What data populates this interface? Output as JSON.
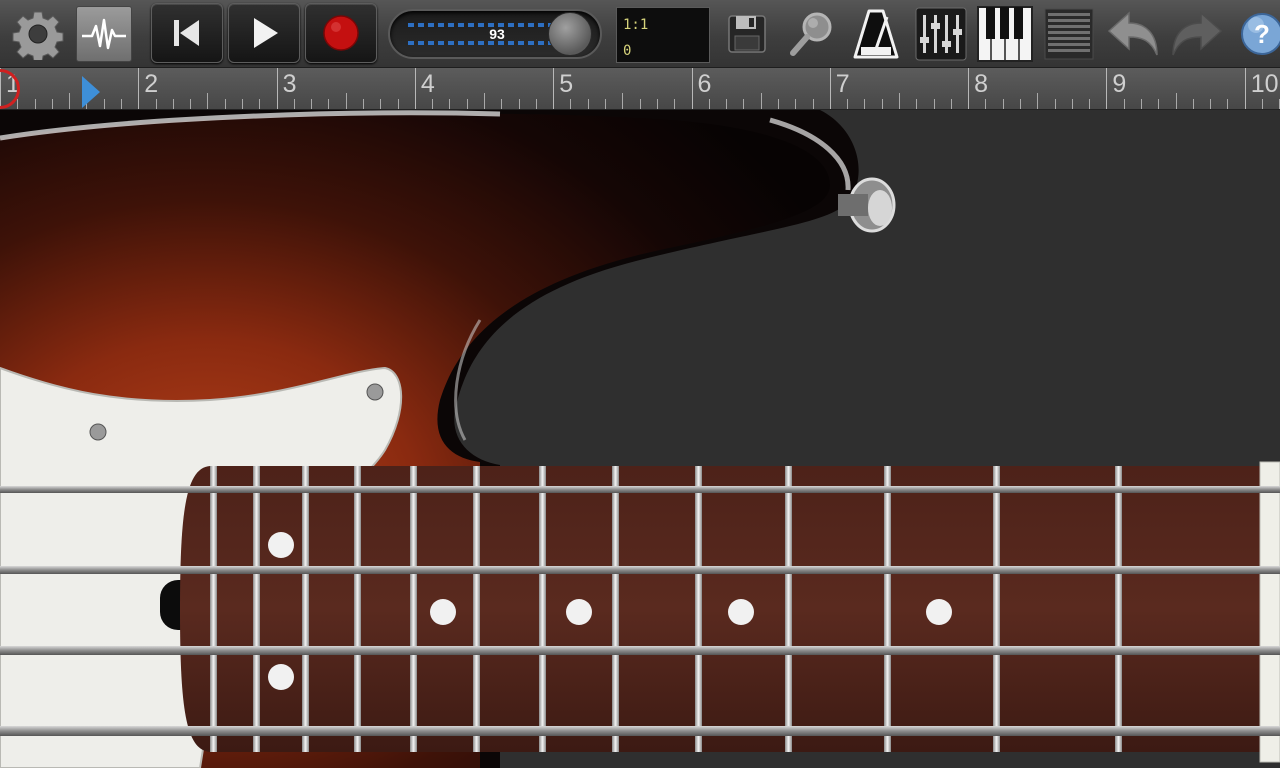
{
  "toolbar": {
    "tempo_value": "93",
    "position_bar_beat": "1:1",
    "position_tick": "0"
  },
  "timeline": {
    "bar_numbers": [
      "1",
      "2",
      "3",
      "4",
      "5",
      "6",
      "7",
      "8",
      "9",
      "10"
    ]
  },
  "icons": {
    "settings": "gear-icon",
    "waveform": "waveform-icon",
    "rewind": "rewind-to-start-icon",
    "play": "play-icon",
    "record": "record-icon",
    "save": "floppy-disk-icon",
    "search": "magnifier-icon",
    "metronome": "metronome-icon",
    "mixer": "mixer-faders-icon",
    "piano": "piano-keys-icon",
    "tracks": "track-list-icon",
    "undo": "undo-arrow-icon",
    "redo": "redo-arrow-icon",
    "help": "help-icon"
  },
  "colors": {
    "record_red": "#c41010",
    "led_blue": "#2d6fc2",
    "display_text": "#d6d37b",
    "playhead_blue": "#3e8fd8",
    "fretboard": "#4b1f17"
  }
}
